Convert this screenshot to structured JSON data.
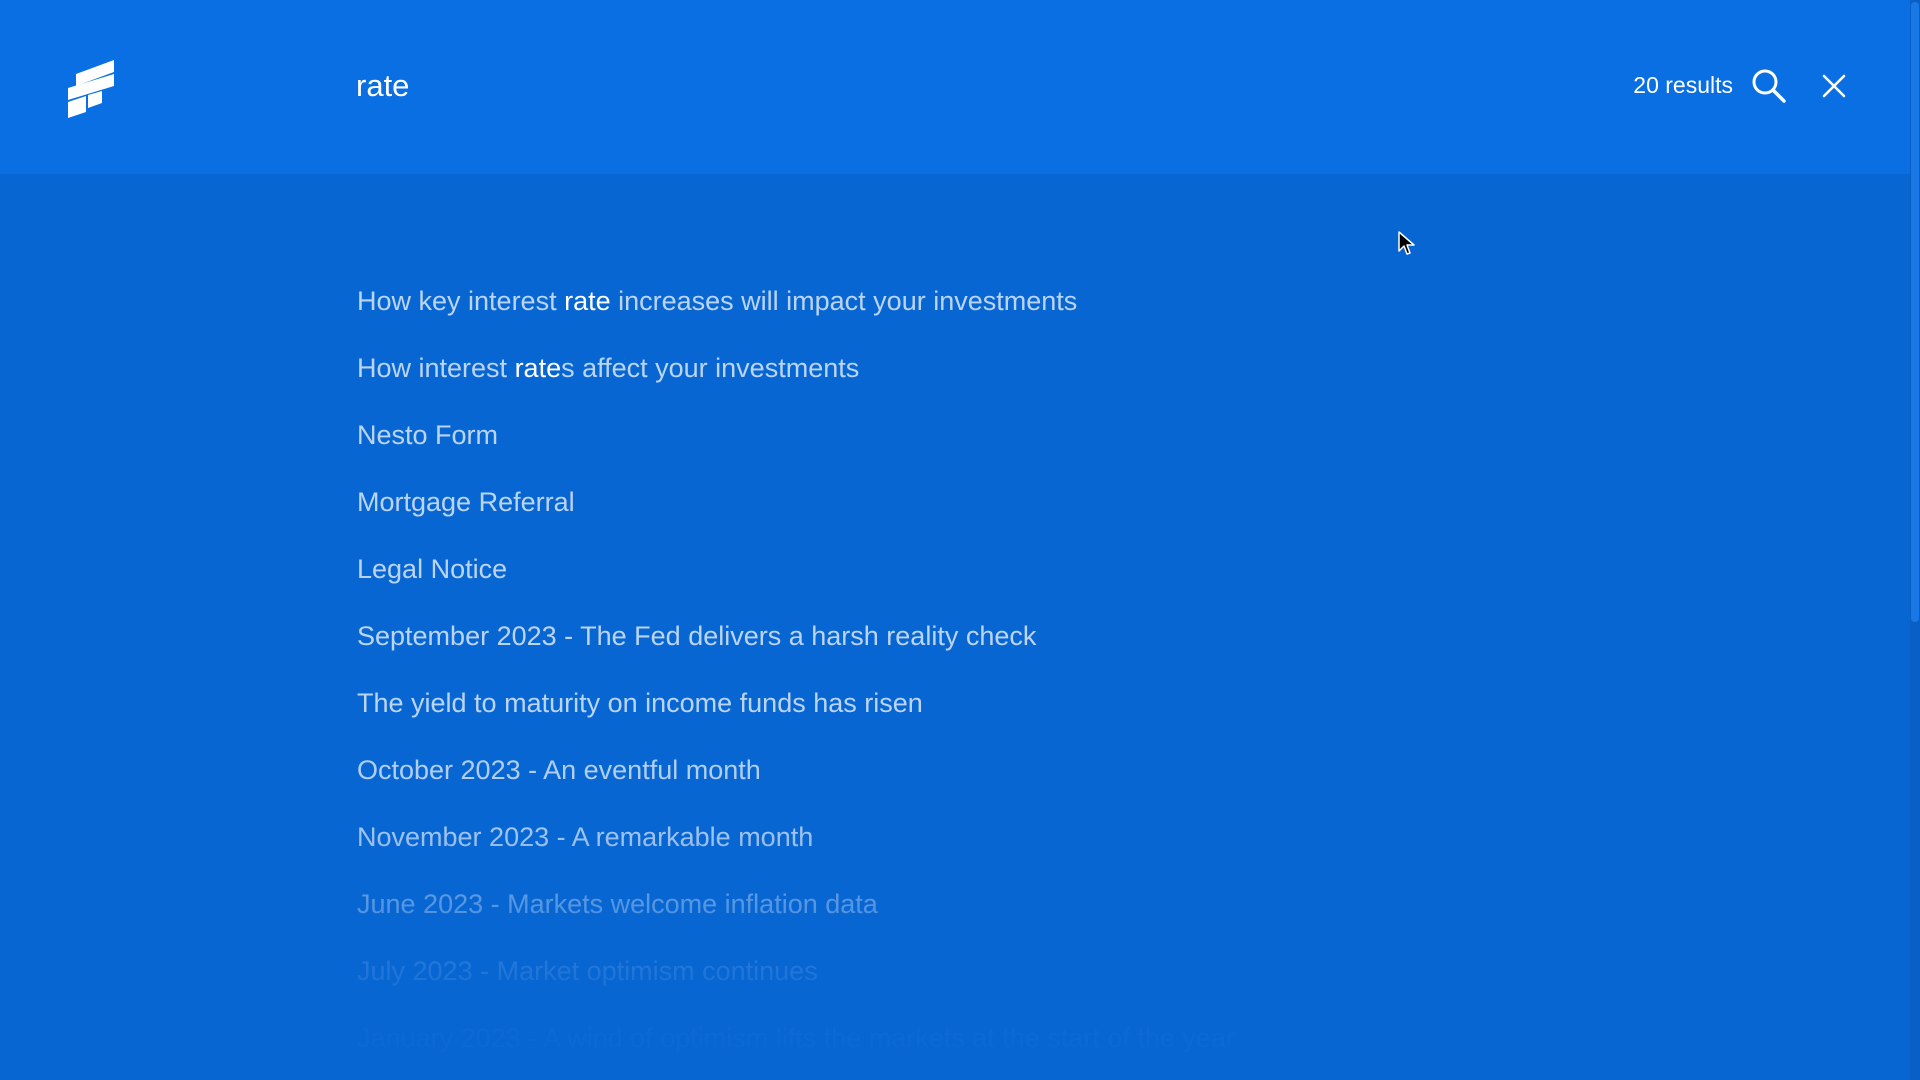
{
  "header": {
    "logo_icon": "brand-flag-logo",
    "search_value": "rate",
    "results_count": "20 results",
    "search_icon": "search-icon",
    "close_icon": "close-icon"
  },
  "colors": {
    "background": "#0866d3",
    "header_background": "#0a6fe2",
    "text_highlight": "#ffffff"
  },
  "results": [
    {
      "before": "How key interest ",
      "match": "rate",
      "after": " increases will impact your investments",
      "opacity": 0.72
    },
    {
      "before": "How interest ",
      "match": "rate",
      "after": "s affect your investments",
      "opacity": 0.72
    },
    {
      "before": "Nesto Form",
      "match": "",
      "after": "",
      "opacity": 0.72
    },
    {
      "before": "Mortgage Referral",
      "match": "",
      "after": "",
      "opacity": 0.72
    },
    {
      "before": "Legal Notice",
      "match": "",
      "after": "",
      "opacity": 0.72
    },
    {
      "before": "September 2023 - The Fed delivers a harsh reality check",
      "match": "",
      "after": "",
      "opacity": 0.72
    },
    {
      "before": "The yield to maturity on income funds has risen",
      "match": "",
      "after": "",
      "opacity": 0.72
    },
    {
      "before": "October 2023 - An eventful month",
      "match": "",
      "after": "",
      "opacity": 0.68
    },
    {
      "before": "November 2023 - A remarkable month",
      "match": "",
      "after": "",
      "opacity": 0.62
    },
    {
      "before": "June 2023 - Markets welcome inflation data",
      "match": "",
      "after": "",
      "opacity": 0.5
    },
    {
      "before": "July 2023 - Market optimism continues",
      "match": "",
      "after": "",
      "opacity": 0.34
    },
    {
      "before": "January 2023 - A wind of optimism lifts the markets at the start of the year",
      "match": "",
      "after": "",
      "opacity": 0.16
    }
  ]
}
